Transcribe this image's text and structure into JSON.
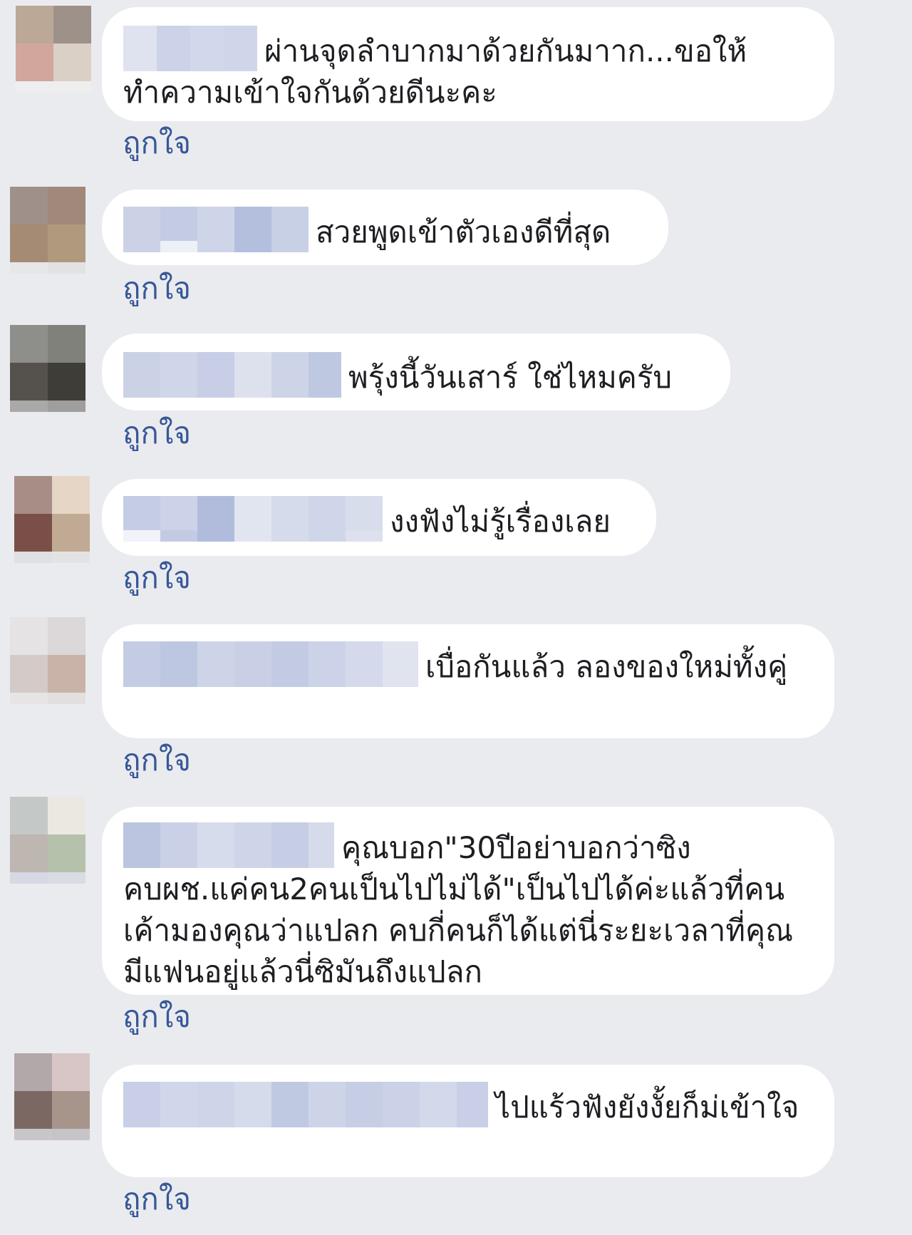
{
  "comments": [
    {
      "text": "ผ่านจุดลำบากมาด้วยกันมาาก...ขอให้ทำความเข้าใจกันด้วยดีนะคะ",
      "like_label": "ถูกใจ"
    },
    {
      "text": "สวยพูดเข้าตัวเองดีที่สุด",
      "like_label": "ถูกใจ"
    },
    {
      "text": "พรุ้งนี้วันเสาร์ ใช่ไหมครับ",
      "like_label": "ถูกใจ"
    },
    {
      "text": "งงฟังไม่รู้เรื่องเลย",
      "like_label": "ถูกใจ"
    },
    {
      "text": "เบื่อกันแล้ว ลองของใหม่ทั้งคู่",
      "like_label": "ถูกใจ"
    },
    {
      "text": "คุณบอก\"30ปีอย่าบอกว่าซิงคบผช.แค่คน2คนเป็นไปไม่ได้\"เป็นไปได้ค่ะแล้วที่คนเค้ามองคุณว่าแปลก คบกี่คนก็ได้แต่นี่ระยะเวลาที่คุณมีแฟนอยู่แล้วนี่ซิมันถึงแปลก",
      "like_label": "ถูกใจ"
    },
    {
      "text": "ไปแร้วฟังยังงั้ยก็ม่เข้าใจ",
      "like_label": "ถูกใจ"
    }
  ],
  "colors": {
    "background": "#eaebef",
    "bubble": "#ffffff",
    "text": "#1c1e21",
    "link": "#385898"
  }
}
